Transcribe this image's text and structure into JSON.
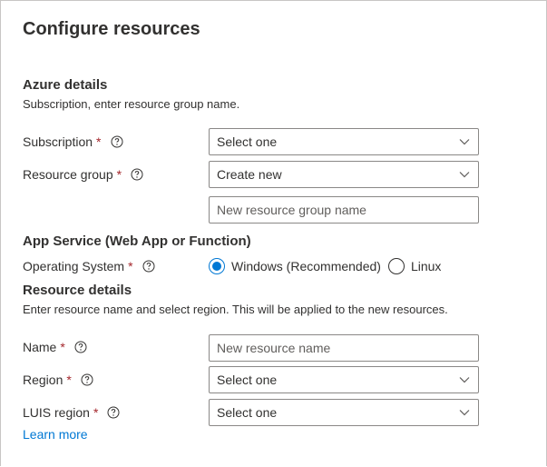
{
  "panel": {
    "title": "Configure resources"
  },
  "azure_details": {
    "heading": "Azure details",
    "description": "Subscription, enter resource group name.",
    "subscription": {
      "label": "Subscription",
      "required_mark": "*",
      "value": "Select one"
    },
    "resource_group": {
      "label": "Resource group",
      "required_mark": "*",
      "value": "Create new",
      "new_name_placeholder": "New resource group name"
    }
  },
  "app_service": {
    "heading": "App Service (Web App or Function)",
    "os": {
      "label": "Operating System",
      "required_mark": "*",
      "options": [
        "Windows (Recommended)",
        "Linux"
      ],
      "selected": "Windows (Recommended)"
    }
  },
  "resource_details": {
    "heading": "Resource details",
    "description": "Enter resource name and select region. This will be applied to the new resources.",
    "name": {
      "label": "Name",
      "required_mark": "*",
      "placeholder": "New resource name"
    },
    "region": {
      "label": "Region",
      "required_mark": "*",
      "value": "Select one"
    },
    "luis_region": {
      "label": "LUIS region",
      "required_mark": "*",
      "value": "Select one"
    }
  },
  "learn_more": "Learn more",
  "icons": {
    "info": "info-icon",
    "dropdown": "chevron-down-icon"
  },
  "colors": {
    "accent": "#0078d4",
    "required": "#a4262c",
    "border": "#8a8886"
  }
}
